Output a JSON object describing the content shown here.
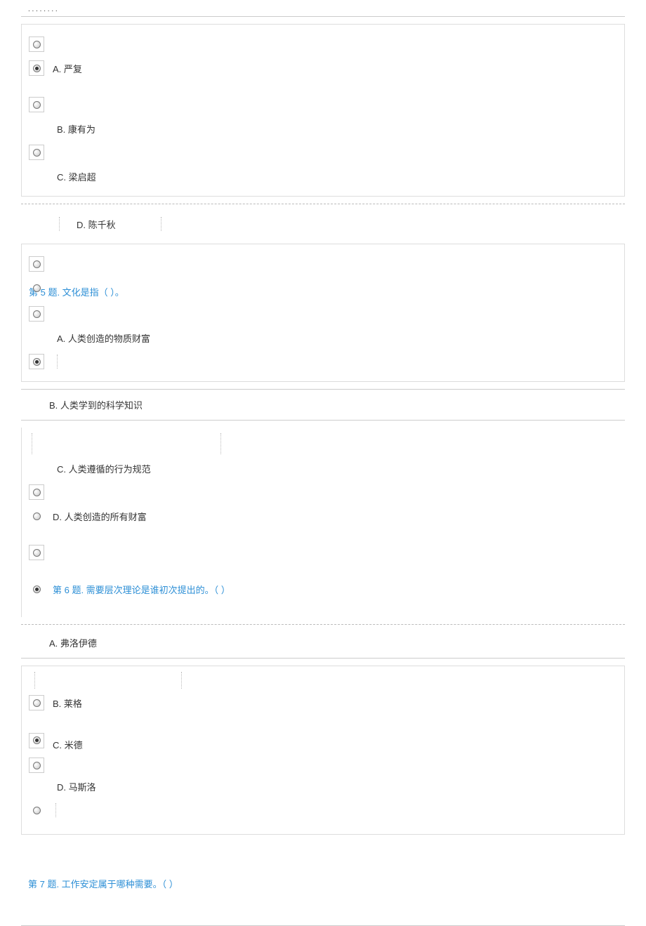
{
  "header_dots": ". .                                   . .                           . .                                          . .",
  "q4": {
    "options": {
      "a": "A. 严复",
      "b": "B. 康有为",
      "c": "C. 梁启超",
      "d": "D. 陈千秋"
    }
  },
  "q5": {
    "label": "第 5 题. 文化是指（ ）。",
    "options": {
      "a": "A. 人类创造的物质财富",
      "b": "B. 人类学到的科学知识",
      "c": "C. 人类遵循的行为规范",
      "d": "D. 人类创造的所有财富"
    }
  },
  "q6": {
    "label": "第 6 题. 需要层次理论是谁初次提出的。（ ）",
    "options": {
      "a": "A. 弗洛伊德",
      "b": "B. 莱格",
      "c": "C. 米德",
      "d": "D. 马斯洛"
    }
  },
  "q7": {
    "label": "第 7 题. 工作安定属于哪种需要。（ ）"
  }
}
